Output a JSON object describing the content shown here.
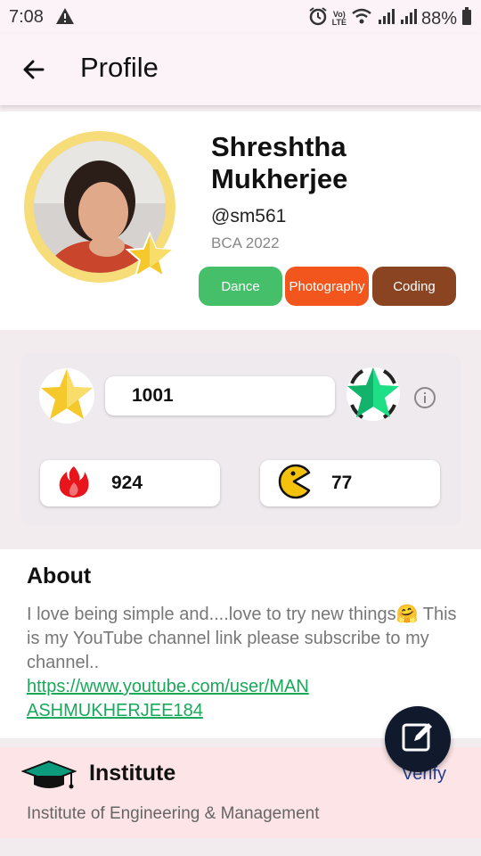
{
  "status_bar": {
    "time": "7:08",
    "battery": "88%",
    "lte_label": "LTE"
  },
  "app_bar": {
    "title": "Profile"
  },
  "profile": {
    "name": "Shreshtha Mukherjee",
    "handle": "@sm561",
    "batch": "BCA 2022",
    "interests": [
      {
        "label": "Dance",
        "color": "#45bf6a"
      },
      {
        "label": "Photography",
        "color": "#f2561d"
      },
      {
        "label": "Coding",
        "color": "#8a4422"
      }
    ]
  },
  "stats": {
    "points": "1001",
    "streak": "924",
    "games": "77"
  },
  "about": {
    "title": "About",
    "bio": "I love being simple and....love to try new things🤗 This is my YouTube channel link please subscribe to my channel..",
    "link": "https://www.youtube.com/user/MANASHMUKHERJEE184"
  },
  "institute": {
    "title": "Institute",
    "name": "Institute of Engineering & Management",
    "verify_label": "Verify"
  },
  "icons": {
    "back": "arrow-left-icon",
    "info": "info-icon",
    "fire": "fire-icon",
    "pacman": "pacman-icon",
    "edit": "edit-icon",
    "grad_cap": "graduation-cap-icon"
  }
}
